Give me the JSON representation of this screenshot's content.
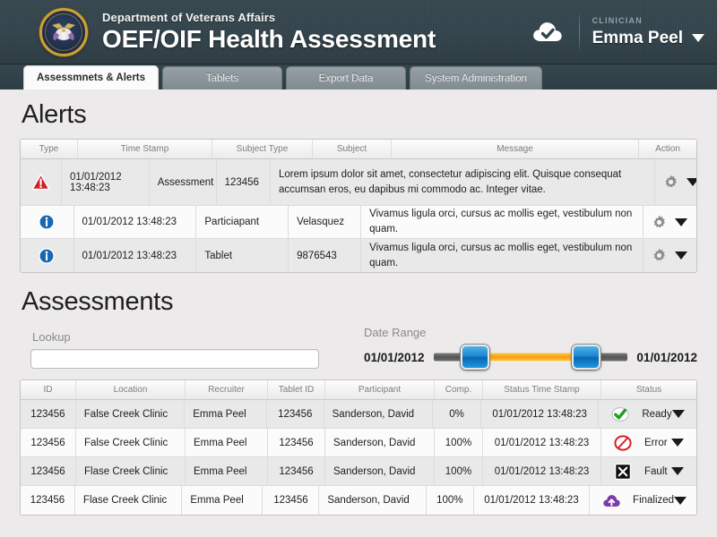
{
  "header": {
    "seal_name": "va-seal",
    "department": "Department of Veterans Affairs",
    "app_title": "OEF/OIF Health Assessment",
    "cloud_icon": "cloud-check-icon",
    "user_role": "CLINICIAN",
    "user_name": "Emma Peel",
    "user_caret": "chevron-down-icon",
    "bg_color": "#32434b"
  },
  "tabs": [
    {
      "label": "Assessmnets & Alerts",
      "active": true
    },
    {
      "label": "Tablets",
      "active": false
    },
    {
      "label": "Export Data",
      "active": false
    },
    {
      "label": "System Administration",
      "active": false
    }
  ],
  "alerts": {
    "title": "Alerts",
    "columns": [
      "Type",
      "Time Stamp",
      "Subject Type",
      "Subject",
      "Message",
      "Action"
    ],
    "rows": [
      {
        "type_icon": "warning-triangle-icon",
        "timestamp": "01/01/2012  13:48:23",
        "subject_type": "Assessment",
        "subject": "123456",
        "message": "Lorem ipsum dolor sit amet, consectetur adipiscing elit. Quisque consequat accumsan eros, eu dapibus mi commodo ac. Integer vitae.",
        "action_gear": "gear-icon",
        "action_caret": "chevron-down-icon"
      },
      {
        "type_icon": "info-circle-icon",
        "timestamp": "01/01/2012  13:48:23",
        "subject_type": "Particiapant",
        "subject": "Velasquez",
        "message": "Vivamus ligula orci, cursus ac mollis eget, vestibulum non quam.",
        "action_gear": "gear-icon",
        "action_caret": "chevron-down-icon"
      },
      {
        "type_icon": "info-circle-icon",
        "timestamp": "01/01/2012  13:48:23",
        "subject_type": "Tablet",
        "subject": "9876543",
        "message": "Vivamus ligula orci, cursus ac mollis eget, vestibulum non quam.",
        "action_gear": "gear-icon",
        "action_caret": "chevron-down-icon"
      }
    ]
  },
  "assessments": {
    "title": "Assessments",
    "lookup_label": "Lookup",
    "lookup_value": "",
    "lookup_placeholder": "",
    "date_range_label": "Date Range",
    "date_start": "01/01/2012",
    "date_end": "01/01/2012",
    "slider_fill_color": "#f5a316",
    "slider_handle_color": "#1b84d0",
    "columns": [
      "ID",
      "Location",
      "Recruiter",
      "Tablet ID",
      "Participant",
      "Comp.",
      "Status Time Stamp",
      "Status"
    ],
    "rows": [
      {
        "id": "123456",
        "location": "False Creek Clinic",
        "recruiter": "Emma Peel",
        "tablet_id": "123456",
        "participant": "Sanderson, David",
        "comp": "0%",
        "status_timestamp": "01/01/2012  13:48:23",
        "status_icon": "check-circle-icon",
        "status": "Ready",
        "status_color": "#19a01e",
        "caret": "chevron-down-icon"
      },
      {
        "id": "123456",
        "location": "False Creek Clinic",
        "recruiter": "Emma Peel",
        "tablet_id": "123456",
        "participant": "Sanderson, David",
        "comp": "100%",
        "status_timestamp": "01/01/2012  13:48:23",
        "status_icon": "no-entry-icon",
        "status": "Error",
        "status_color": "#d81f26",
        "caret": "chevron-down-icon"
      },
      {
        "id": "123456",
        "location": "Flase Creek Clinic",
        "recruiter": "Emma Peel",
        "tablet_id": "123456",
        "participant": "Sanderson, David",
        "comp": "100%",
        "status_timestamp": "01/01/2012  13:48:23",
        "status_icon": "x-square-icon",
        "status": "Fault",
        "status_color": "#111111",
        "caret": "chevron-down-icon"
      },
      {
        "id": "123456",
        "location": "Flase Creek Clinic",
        "recruiter": "Emma Peel",
        "tablet_id": "123456",
        "participant": "Sanderson, David",
        "comp": "100%",
        "status_timestamp": "01/01/2012  13:48:23",
        "status_icon": "cloud-upload-icon",
        "status": "Finalized",
        "status_color": "#7d3ba8",
        "caret": "chevron-down-icon"
      }
    ]
  }
}
